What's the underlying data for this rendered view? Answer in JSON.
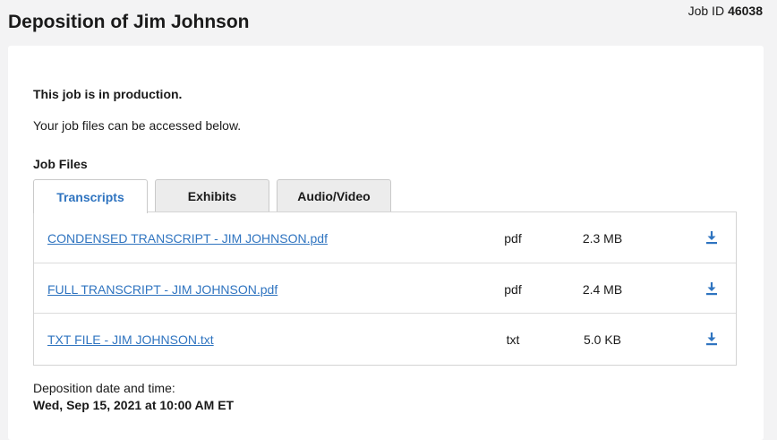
{
  "header": {
    "title": "Deposition of Jim Johnson",
    "job_id_label": "Job ID",
    "job_id_value": "46038"
  },
  "status": {
    "heading": "This job is in production.",
    "message": "Your job files can be accessed below."
  },
  "files_section": {
    "heading": "Job Files",
    "tabs": [
      {
        "label": "Transcripts",
        "active": true
      },
      {
        "label": "Exhibits",
        "active": false
      },
      {
        "label": "Audio/Video",
        "active": false
      }
    ],
    "rows": [
      {
        "name": "CONDENSED TRANSCRIPT - JIM JOHNSON.pdf",
        "type": "pdf",
        "size": "2.3 MB",
        "action_icon": "download-icon"
      },
      {
        "name": "FULL TRANSCRIPT - JIM JOHNSON.pdf",
        "type": "pdf",
        "size": "2.4 MB",
        "action_icon": "download-icon"
      },
      {
        "name": "TXT FILE - JIM JOHNSON.txt",
        "type": "txt",
        "size": "5.0 KB",
        "action_icon": "download-icon"
      }
    ]
  },
  "deposition": {
    "date_label": "Deposition date and time:",
    "date_value": "Wed, Sep 15, 2021 at 10:00 AM ET"
  },
  "colors": {
    "link": "#2f74c0",
    "active_tab_text": "#2f74c0",
    "page_background": "#f3f3f4",
    "card_background": "#ffffff"
  }
}
